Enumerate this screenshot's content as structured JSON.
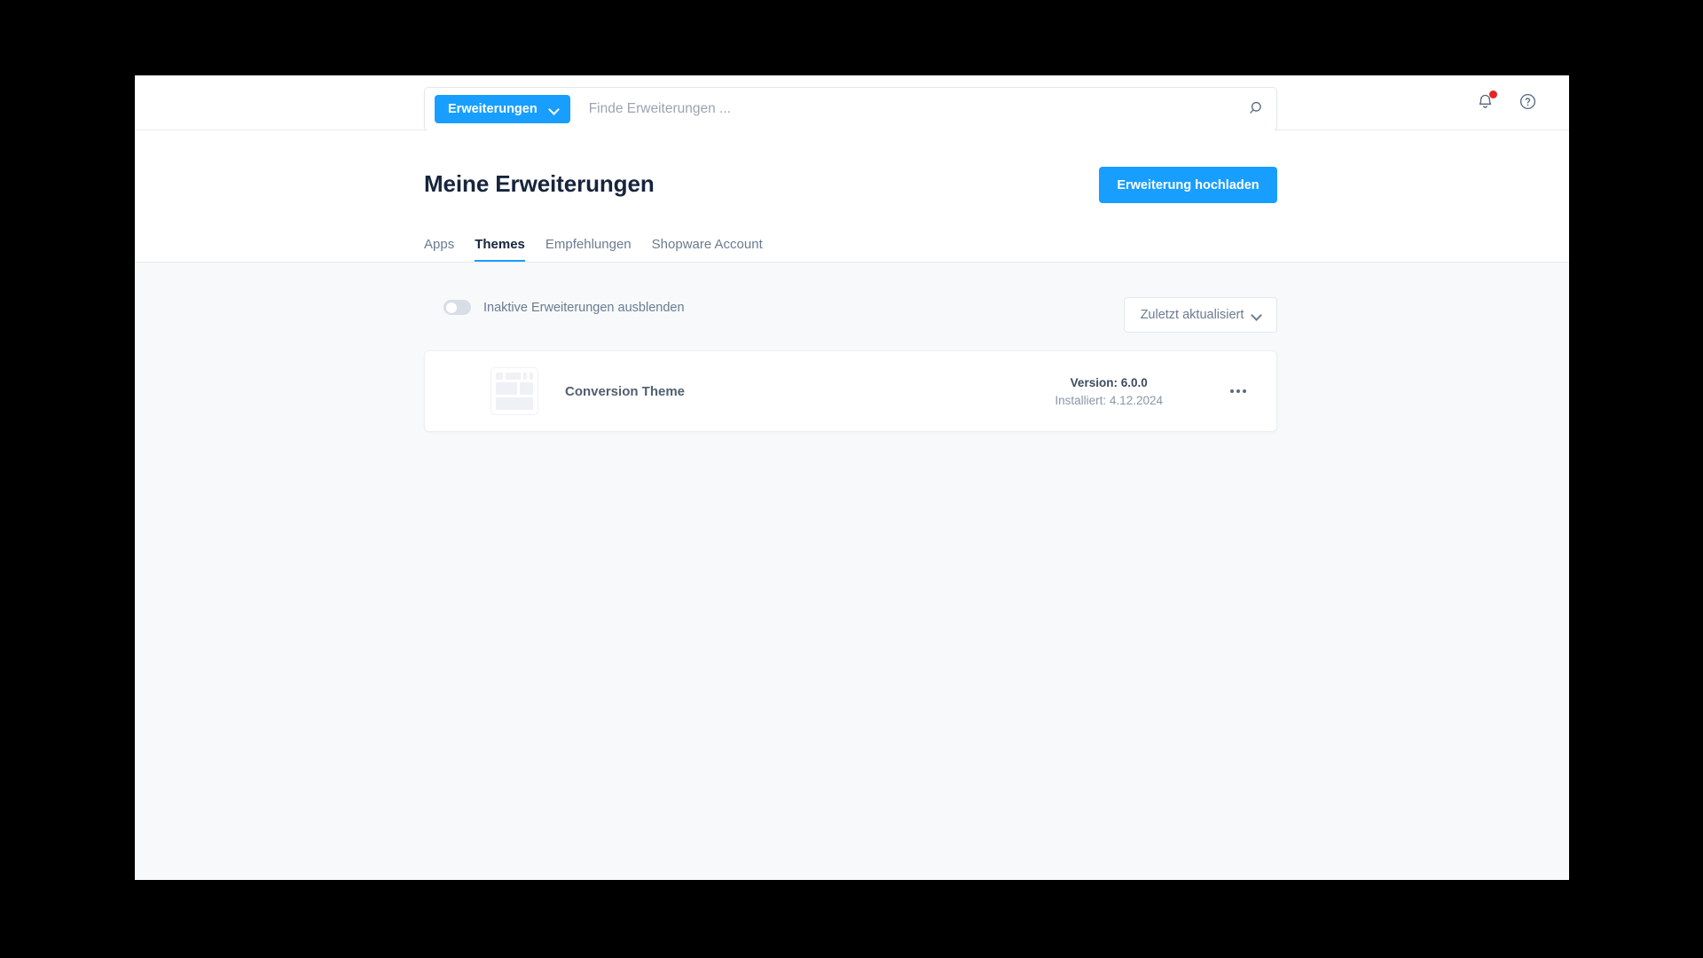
{
  "topbar": {
    "search_type_label": "Erweiterungen",
    "search_placeholder": "Finde Erweiterungen ...",
    "search_value": "",
    "search_icon": "search-icon",
    "notifications_icon": "bell-icon",
    "help_icon": "help-circle-icon",
    "has_notification_badge": true
  },
  "header": {
    "title": "Meine Erweiterungen",
    "upload_button_label": "Erweiterung hochladen",
    "tabs": [
      {
        "label": "Apps",
        "active": false
      },
      {
        "label": "Themes",
        "active": true
      },
      {
        "label": "Empfehlungen",
        "active": false
      },
      {
        "label": "Shopware Account",
        "active": false
      }
    ]
  },
  "filters": {
    "hide_inactive_label": "Inaktive Erweiterungen ausblenden",
    "hide_inactive_enabled": false,
    "sort_label": "Zuletzt aktualisiert"
  },
  "extensions": [
    {
      "name": "Conversion Theme",
      "active": true,
      "version_label": "Version: 6.0.0",
      "installed_label": "Installiert: 4.12.2024",
      "menu_icon": "more-horizontal-icon",
      "thumbnail_icon": "theme-placeholder-icon"
    }
  ],
  "colors": {
    "accent": "#189eff",
    "badge_red": "#e52427",
    "title": "#16243c",
    "page_background": "#f7f9fb",
    "surface": "#ffffff"
  }
}
